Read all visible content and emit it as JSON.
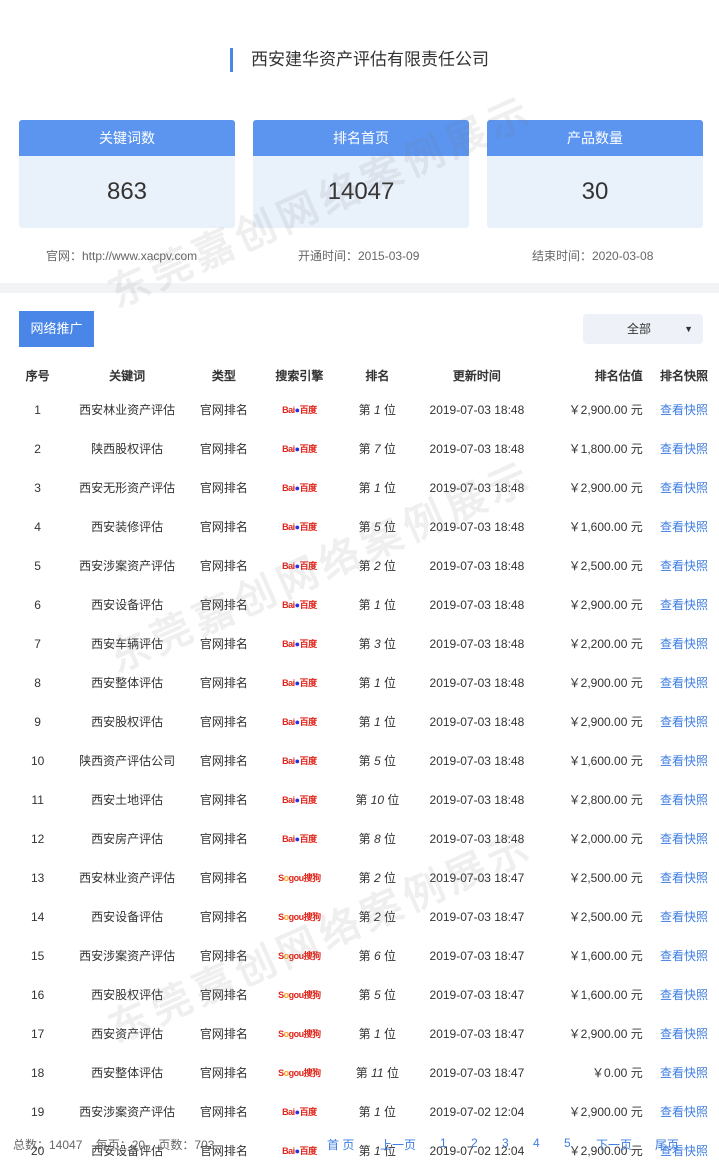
{
  "header": {
    "title": "西安建华资产评估有限责任公司"
  },
  "stats": [
    {
      "label": "关键词数",
      "value": "863"
    },
    {
      "label": "排名首页",
      "value": "14047"
    },
    {
      "label": "产品数量",
      "value": "30"
    }
  ],
  "meta": {
    "website": "官网：http://www.xacpv.com",
    "start": "开通时间：2015-03-09",
    "end": "结束时间：2020-03-08"
  },
  "tab": {
    "label": "网络推广"
  },
  "filter": {
    "selected": "全部"
  },
  "watermark": "东莞嘉创网络案例展示",
  "columns": [
    "序号",
    "关键词",
    "类型",
    "搜索引擎",
    "排名",
    "更新时间",
    "排名估值",
    "排名快照"
  ],
  "engines": {
    "baidu": "Bai百度",
    "sogou": "Sogou搜狗"
  },
  "rows": [
    {
      "seq": "1",
      "keyword": "西安林业资产评估",
      "type": "官网排名",
      "engine": "baidu",
      "rank": "1",
      "time": "2019-07-03 18:48",
      "value": "￥2,900.00 元"
    },
    {
      "seq": "2",
      "keyword": "陕西股权评估",
      "type": "官网排名",
      "engine": "baidu",
      "rank": "7",
      "time": "2019-07-03 18:48",
      "value": "￥1,800.00 元"
    },
    {
      "seq": "3",
      "keyword": "西安无形资产评估",
      "type": "官网排名",
      "engine": "baidu",
      "rank": "1",
      "time": "2019-07-03 18:48",
      "value": "￥2,900.00 元"
    },
    {
      "seq": "4",
      "keyword": "西安装修评估",
      "type": "官网排名",
      "engine": "baidu",
      "rank": "5",
      "time": "2019-07-03 18:48",
      "value": "￥1,600.00 元"
    },
    {
      "seq": "5",
      "keyword": "西安涉案资产评估",
      "type": "官网排名",
      "engine": "baidu",
      "rank": "2",
      "time": "2019-07-03 18:48",
      "value": "￥2,500.00 元"
    },
    {
      "seq": "6",
      "keyword": "西安设备评估",
      "type": "官网排名",
      "engine": "baidu",
      "rank": "1",
      "time": "2019-07-03 18:48",
      "value": "￥2,900.00 元"
    },
    {
      "seq": "7",
      "keyword": "西安车辆评估",
      "type": "官网排名",
      "engine": "baidu",
      "rank": "3",
      "time": "2019-07-03 18:48",
      "value": "￥2,200.00 元"
    },
    {
      "seq": "8",
      "keyword": "西安整体评估",
      "type": "官网排名",
      "engine": "baidu",
      "rank": "1",
      "time": "2019-07-03 18:48",
      "value": "￥2,900.00 元"
    },
    {
      "seq": "9",
      "keyword": "西安股权评估",
      "type": "官网排名",
      "engine": "baidu",
      "rank": "1",
      "time": "2019-07-03 18:48",
      "value": "￥2,900.00 元"
    },
    {
      "seq": "10",
      "keyword": "陕西资产评估公司",
      "type": "官网排名",
      "engine": "baidu",
      "rank": "5",
      "time": "2019-07-03 18:48",
      "value": "￥1,600.00 元"
    },
    {
      "seq": "11",
      "keyword": "西安土地评估",
      "type": "官网排名",
      "engine": "baidu",
      "rank": "10",
      "time": "2019-07-03 18:48",
      "value": "￥2,800.00 元"
    },
    {
      "seq": "12",
      "keyword": "西安房产评估",
      "type": "官网排名",
      "engine": "baidu",
      "rank": "8",
      "time": "2019-07-03 18:48",
      "value": "￥2,000.00 元"
    },
    {
      "seq": "13",
      "keyword": "西安林业资产评估",
      "type": "官网排名",
      "engine": "sogou",
      "rank": "2",
      "time": "2019-07-03 18:47",
      "value": "￥2,500.00 元"
    },
    {
      "seq": "14",
      "keyword": "西安设备评估",
      "type": "官网排名",
      "engine": "sogou",
      "rank": "2",
      "time": "2019-07-03 18:47",
      "value": "￥2,500.00 元"
    },
    {
      "seq": "15",
      "keyword": "西安涉案资产评估",
      "type": "官网排名",
      "engine": "sogou",
      "rank": "6",
      "time": "2019-07-03 18:47",
      "value": "￥1,600.00 元"
    },
    {
      "seq": "16",
      "keyword": "西安股权评估",
      "type": "官网排名",
      "engine": "sogou",
      "rank": "5",
      "time": "2019-07-03 18:47",
      "value": "￥1,600.00 元"
    },
    {
      "seq": "17",
      "keyword": "西安资产评估",
      "type": "官网排名",
      "engine": "sogou",
      "rank": "1",
      "time": "2019-07-03 18:47",
      "value": "￥2,900.00 元"
    },
    {
      "seq": "18",
      "keyword": "西安整体评估",
      "type": "官网排名",
      "engine": "sogou",
      "rank": "11",
      "time": "2019-07-03 18:47",
      "value": "￥0.00 元"
    },
    {
      "seq": "19",
      "keyword": "西安涉案资产评估",
      "type": "官网排名",
      "engine": "baidu",
      "rank": "1",
      "time": "2019-07-02 12:04",
      "value": "￥2,900.00 元"
    },
    {
      "seq": "20",
      "keyword": "西安设备评估",
      "type": "官网排名",
      "engine": "baidu",
      "rank": "1",
      "time": "2019-07-02 12:04",
      "value": "￥2,900.00 元"
    }
  ],
  "rank_prefix": "第",
  "rank_suffix": "位",
  "snapshot_label": "查看快照",
  "footer": {
    "summary": "总数：14047    每页：20    页数：703",
    "pager": [
      "首 页",
      "上一页",
      "1",
      "2",
      "3",
      "4",
      "5",
      "下一页",
      "尾页"
    ]
  },
  "colors": {
    "accent": "#4a86e8",
    "card_header": "#5b95f0",
    "card_body": "#e9f1fb",
    "link": "#3e7de0"
  }
}
